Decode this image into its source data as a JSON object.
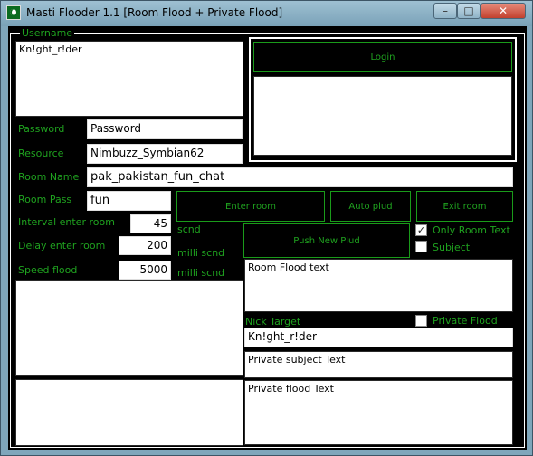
{
  "window": {
    "title": "Masti Flooder 1.1 [Room Flood + Private Flood]",
    "controls": {
      "minimize": "–",
      "maximize": "□",
      "close": "✕"
    }
  },
  "colors": {
    "accent": "#1fa21f",
    "background": "#000000"
  },
  "group": {
    "legend": "Username"
  },
  "username": {
    "value": "Kn!ght_r!der"
  },
  "password": {
    "label": "Password",
    "value": "Password"
  },
  "resource": {
    "label": "Resource",
    "value": "Nimbuzz_Symbian62"
  },
  "room_name": {
    "label": "Room Name",
    "value": "pak_pakistan_fun_chat"
  },
  "room_pass": {
    "label": "Room Pass",
    "value": "fun"
  },
  "interval": {
    "label": "Interval enter room",
    "value": "45",
    "unit": "scnd"
  },
  "delay": {
    "label": "Delay enter room",
    "value": "200",
    "unit": "milli scnd"
  },
  "speed": {
    "label": "Speed flood",
    "value": "5000",
    "unit": "milli scnd"
  },
  "buttons": {
    "login": "Login",
    "enter_room": "Enter room",
    "auto_plud": "Auto plud",
    "exit_room": "Exit room",
    "push_new_plud": "Push New Plud"
  },
  "options": {
    "only_room_text": {
      "label": "Only Room Text",
      "checked": true,
      "mark": "✓"
    },
    "subject": {
      "label": "Subject",
      "checked": false
    },
    "private_flood": {
      "label": "Private Flood",
      "checked": false
    }
  },
  "room_flood_text": {
    "value": "Room Flood text"
  },
  "nick_target": {
    "label": "Nick Target",
    "value": "Kn!ght_r!der"
  },
  "private_subject": {
    "value": "Private subject Text"
  },
  "private_flood_text": {
    "value": "Private flood Text"
  }
}
